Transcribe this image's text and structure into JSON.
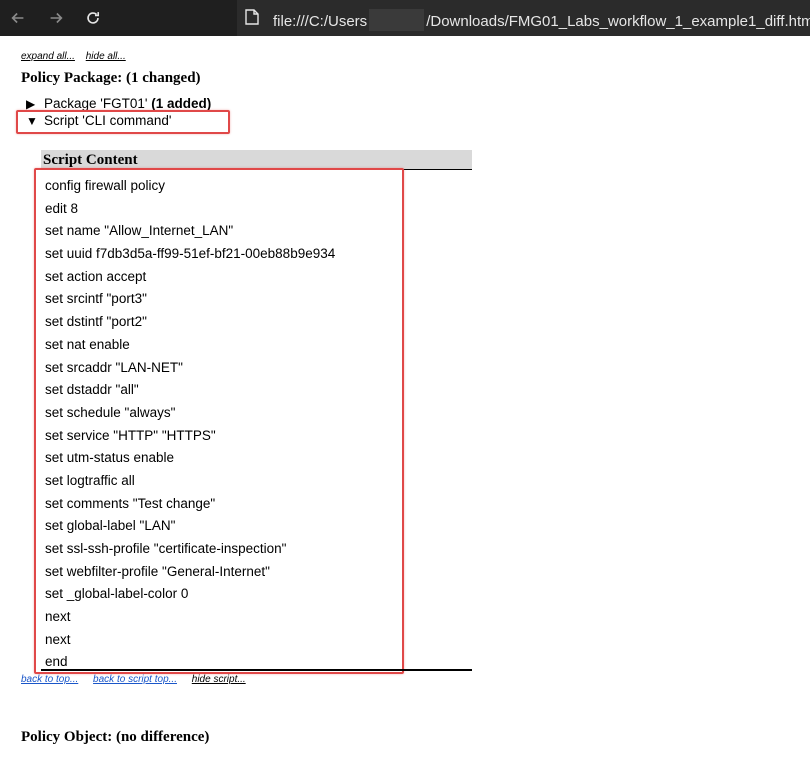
{
  "browser": {
    "url_prefix": "file:///C:/Users",
    "url_suffix": "/Downloads/FMG01_Labs_workflow_1_example1_diff.html"
  },
  "page": {
    "top_links": {
      "expand_all": "expand all...",
      "hide_all": "hide all..."
    },
    "policy_package_title": "Policy Package: (1 changed)",
    "package_row": {
      "label": "Package 'FGT01' ",
      "badge": "(1 added)"
    },
    "script_row": {
      "label": "Script 'CLI command'"
    },
    "script_content_header": "Script Content",
    "script_lines": [
      "config firewall policy",
      "edit 8",
      "set name \"Allow_Internet_LAN\"",
      "set uuid f7db3d5a-ff99-51ef-bf21-00eb88b9e934",
      "set action accept",
      "set srcintf \"port3\"",
      "set dstintf \"port2\"",
      "set nat enable",
      "set srcaddr \"LAN-NET\"",
      "set dstaddr \"all\"",
      "set schedule \"always\"",
      "set service \"HTTP\" \"HTTPS\"",
      "set utm-status enable",
      "set logtraffic all",
      "set comments \"Test change\"",
      "set global-label \"LAN\"",
      "set ssl-ssh-profile \"certificate-inspection\"",
      "set webfilter-profile \"General-Internet\"",
      "set _global-label-color 0",
      "next",
      "next",
      "end"
    ],
    "bottom_links": {
      "back_to_top": "back to top...",
      "back_to_script_top": "back to script top...",
      "hide_script": "hide script..."
    },
    "policy_object_title": "Policy Object: (no difference)"
  },
  "colors": {
    "highlight": "#e04848",
    "chrome_bg": "#1f1f1f",
    "link_blue": "#1a56c9"
  }
}
